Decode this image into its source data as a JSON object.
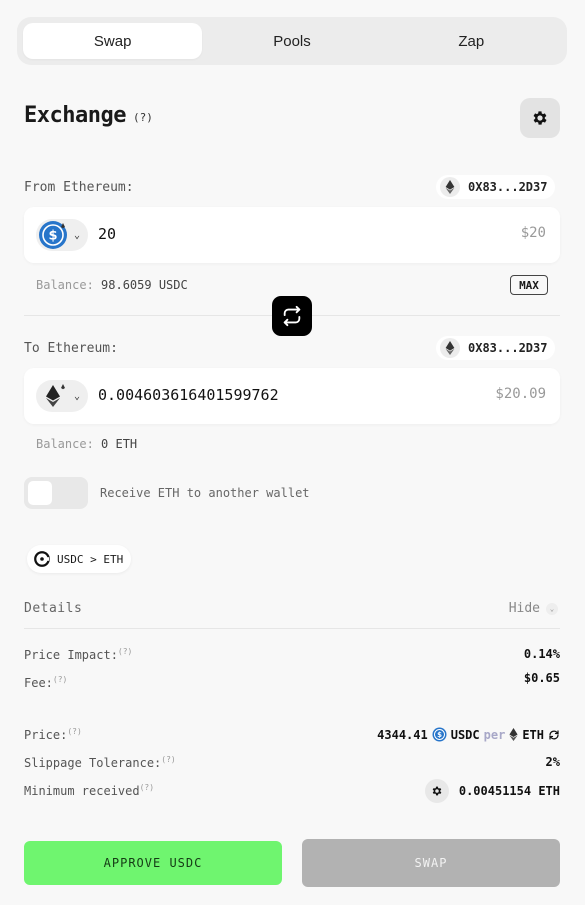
{
  "tabs": [
    {
      "label": "Swap",
      "active": true
    },
    {
      "label": "Pools",
      "active": false
    },
    {
      "label": "Zap",
      "active": false
    }
  ],
  "header": {
    "title": "Exchange",
    "help": "(?)",
    "settings_icon": "gear-icon"
  },
  "from": {
    "label": "From Ethereum:",
    "address": "0X83...2D37",
    "token_icon": "usdc-icon",
    "amount": "20",
    "usd_value": "$20",
    "balance_label": "Balance:",
    "balance_value": "98.6059 USDC",
    "max_label": "MAX"
  },
  "to": {
    "label": "To Ethereum:",
    "address": "0X83...2D37",
    "token_icon": "eth-icon",
    "amount": "0.004603616401599762",
    "usd_value": "$20.09",
    "balance_label": "Balance:",
    "balance_value": "0 ETH"
  },
  "toggle": {
    "label": "Receive ETH to another wallet",
    "on": false
  },
  "route": {
    "text": "USDC > ETH"
  },
  "details": {
    "heading": "Details",
    "hide_label": "Hide",
    "price_impact": {
      "label": "Price Impact:",
      "q": "(?)",
      "value": "0.14%"
    },
    "fee": {
      "label": "Fee:",
      "q": "(?)",
      "value": "$0.65"
    },
    "price": {
      "label": "Price:",
      "q": "(?)",
      "amount": "4344.41",
      "base": "USDC",
      "per": "per",
      "quote": "ETH"
    },
    "slippage": {
      "label": "Slippage Tolerance:",
      "q": "(?)",
      "value": "2%"
    },
    "minimum": {
      "label": "Minimum received",
      "q": "(?)",
      "value": "0.00451154 ETH"
    }
  },
  "buttons": {
    "approve": "APPROVE USDC",
    "swap": "SWAP"
  },
  "colors": {
    "approve_bg": "#6ff56f",
    "swap_bg": "#b2b2b2",
    "usdc_blue": "#2775ca"
  }
}
